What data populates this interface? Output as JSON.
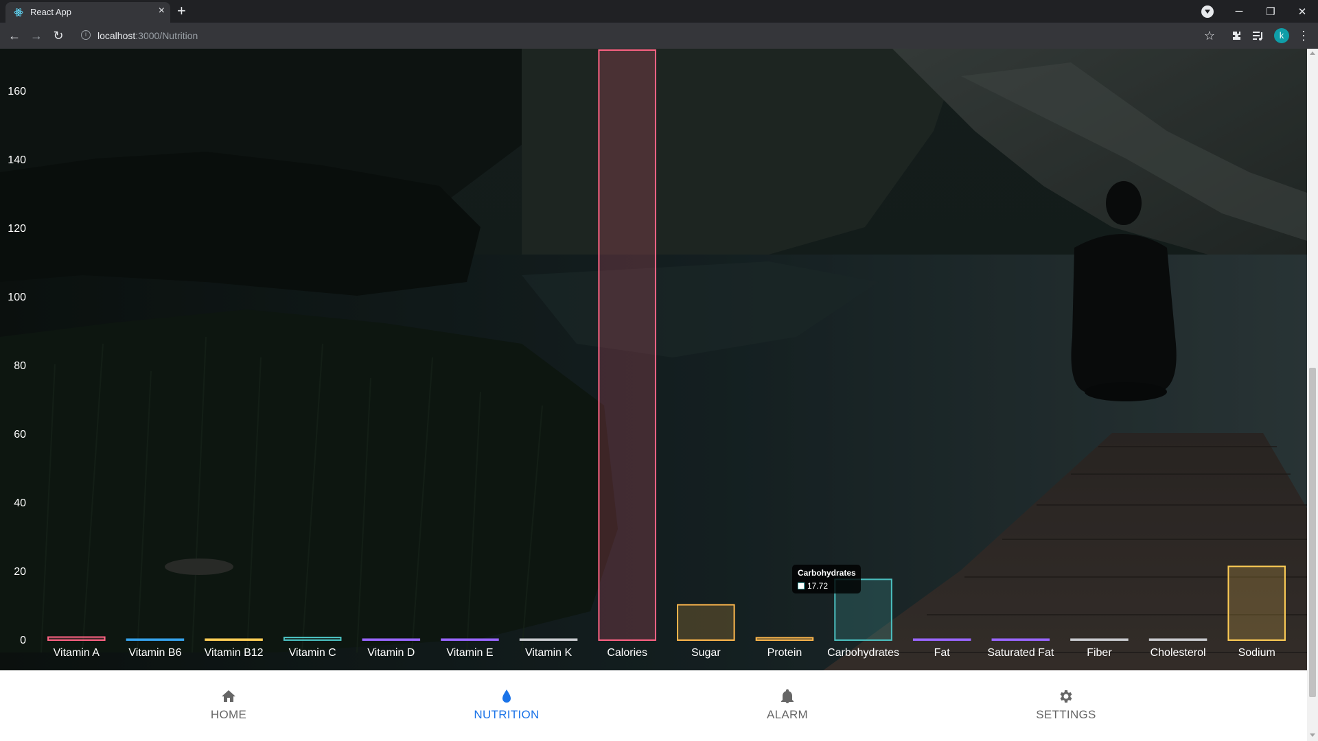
{
  "browser": {
    "tab_title": "React App",
    "url_host": "localhost",
    "url_path": ":3000/Nutrition",
    "profile_initial": "k"
  },
  "nav": {
    "items": [
      {
        "label": "HOME",
        "icon": "home-icon",
        "active": false
      },
      {
        "label": "NUTRITION",
        "icon": "water-drop-icon",
        "active": true
      },
      {
        "label": "ALARM",
        "icon": "bell-icon",
        "active": false
      },
      {
        "label": "SETTINGS",
        "icon": "gear-icon",
        "active": false
      }
    ],
    "active_color": "#1a73e8",
    "inactive_color": "#666666"
  },
  "tooltip": {
    "title": "Carbohydrates",
    "value": "17.72"
  },
  "chart_data": {
    "type": "bar",
    "categories": [
      "Vitamin A",
      "Vitamin B6",
      "Vitamin B12",
      "Vitamin C",
      "Vitamin D",
      "Vitamin E",
      "Vitamin K",
      "Calories",
      "Sugar",
      "Protein",
      "Carbohydrates",
      "Fat",
      "Saturated Fat",
      "Fiber",
      "Cholesterol",
      "Sodium"
    ],
    "values": [
      0.9,
      0.1,
      0.2,
      0.8,
      0,
      0.2,
      0,
      172,
      10.3,
      0.7,
      17.72,
      0,
      0.1,
      0.3,
      0,
      21.5
    ],
    "colors": [
      "#ff6384",
      "#36a2eb",
      "#ffce56",
      "#4bc0c0",
      "#9966ff",
      "#9966ff",
      "#c9cbcf",
      "#ff6384",
      "#ffb84d",
      "#ffb84d",
      "#4bc0c0",
      "#9966ff",
      "#9966ff",
      "#c9cbcf",
      "#c9cbcf",
      "#ffce56"
    ],
    "yticks": [
      0,
      20,
      40,
      60,
      80,
      100,
      120,
      140,
      160
    ],
    "ylim": [
      0,
      172
    ],
    "grid": false,
    "legend": false
  }
}
